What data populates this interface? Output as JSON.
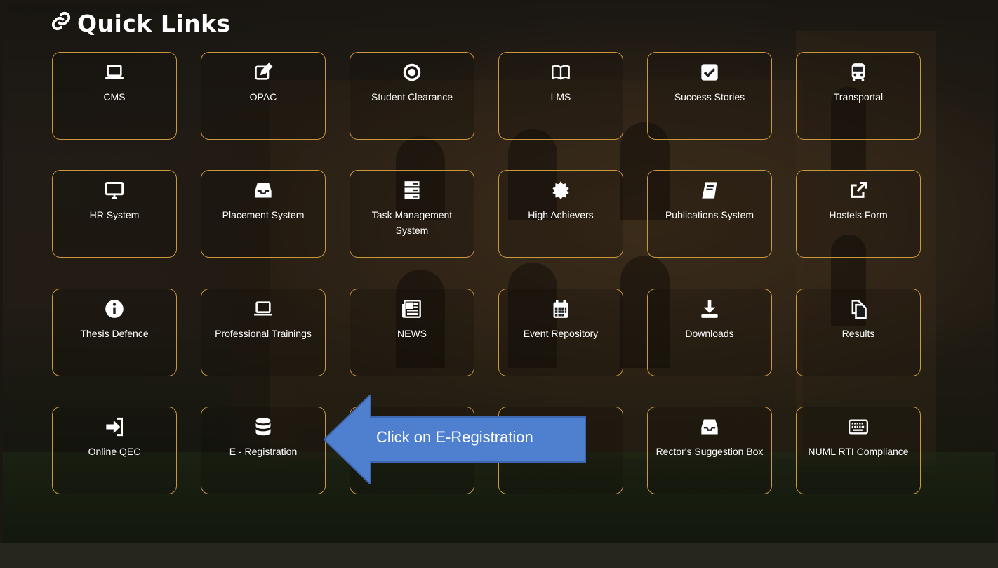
{
  "section": {
    "title": "Quick Links",
    "icon": "link-icon"
  },
  "tiles": [
    {
      "label": "CMS",
      "icon": "laptop-icon"
    },
    {
      "label": "OPAC",
      "icon": "edit-icon"
    },
    {
      "label": "Student Clearance",
      "icon": "target-icon"
    },
    {
      "label": "LMS",
      "icon": "book-icon"
    },
    {
      "label": "Success Stories",
      "icon": "checkbox-icon"
    },
    {
      "label": "Transportal",
      "icon": "bus-icon"
    },
    {
      "label": "HR System",
      "icon": "monitor-icon"
    },
    {
      "label": "Placement System",
      "icon": "inbox-icon"
    },
    {
      "label": "Task Management System",
      "icon": "server-icon"
    },
    {
      "label": "High Achievers",
      "icon": "certificate-icon"
    },
    {
      "label": "Publications System",
      "icon": "book-solid-icon"
    },
    {
      "label": "Hostels Form",
      "icon": "external-link-icon"
    },
    {
      "label": "Thesis Defence",
      "icon": "info-icon"
    },
    {
      "label": "Professional Trainings",
      "icon": "laptop-icon"
    },
    {
      "label": "NEWS",
      "icon": "newspaper-icon"
    },
    {
      "label": "Event Repository",
      "icon": "calendar-icon"
    },
    {
      "label": "Downloads",
      "icon": "download-icon"
    },
    {
      "label": "Results",
      "icon": "copy-icon"
    },
    {
      "label": "Online QEC",
      "icon": "sign-in-icon"
    },
    {
      "label": "E - Registration",
      "icon": "database-icon"
    },
    {
      "label": "",
      "icon": ""
    },
    {
      "label": "",
      "icon": ""
    },
    {
      "label": "Rector's Suggestion Box",
      "icon": "inbox-icon"
    },
    {
      "label": "NUML RTI Compliance",
      "icon": "keyboard-icon"
    }
  ],
  "callout": {
    "text": "Click on E-Registration",
    "color": "#4f7fcf"
  },
  "colors": {
    "tile_border": "#c9973c"
  }
}
